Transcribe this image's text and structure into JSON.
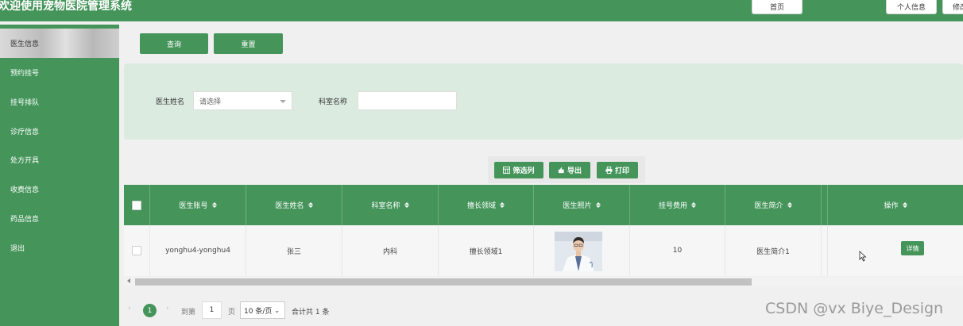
{
  "header": {
    "app_title": "欢迎使用宠物医院管理系统",
    "buttons": [
      "首页",
      "个人信息",
      "修改"
    ]
  },
  "sidebar": {
    "items": [
      "医生信息",
      "预约挂号",
      "挂号排队",
      "诊疗信息",
      "处方开具",
      "收费信息",
      "药品信息",
      "退出"
    ],
    "active_index": 0
  },
  "actions": {
    "search_label": "查询",
    "reset_label": "重置"
  },
  "search_form": {
    "doctor_name_label": "医生姓名",
    "doctor_name_placeholder": "请选择",
    "department_label": "科室名称",
    "department_value": ""
  },
  "toolbar": {
    "filter_columns": "筛选列",
    "export": "导出",
    "print": "打印"
  },
  "table": {
    "columns": [
      "医生账号",
      "医生姓名",
      "科室名称",
      "擅长领域",
      "医生照片",
      "挂号费用",
      "医生简介",
      "操作"
    ],
    "rows": [
      {
        "account": "yonghu4-yonghu4",
        "name": "张三",
        "department": "内科",
        "specialty": "擅长领域1",
        "fee": "10",
        "intro": "医生简介1",
        "action": "详情"
      }
    ]
  },
  "pagination": {
    "current_page": "1",
    "goto_label": "到第",
    "page_input": "1",
    "page_unit": "页",
    "page_size": "10 条/页",
    "total_text": "合计共 1 条"
  },
  "watermark": "CSDN @vx Biye_Design",
  "colors": {
    "primary": "#45955b",
    "panel": "#dcebe0",
    "background": "#f0f0f0"
  }
}
